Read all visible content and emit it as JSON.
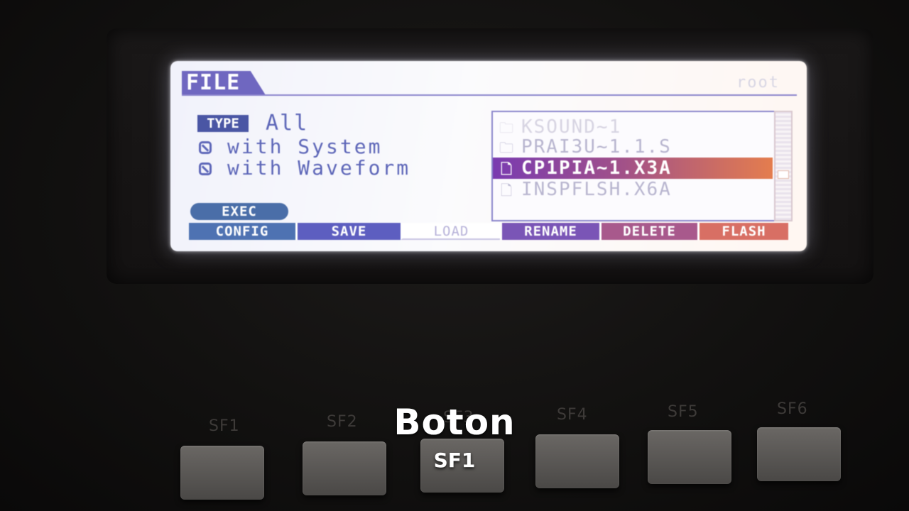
{
  "screen": {
    "title": "FILE",
    "path": "root",
    "type_label": "TYPE",
    "type_value": "All",
    "options": [
      {
        "label": "with System",
        "checked": true
      },
      {
        "label": "with Waveform",
        "checked": true
      }
    ],
    "exec_label": "EXEC",
    "files": [
      {
        "name": "KSOUND~1",
        "kind": "folder-icon",
        "selected": false
      },
      {
        "name": "PRAI3U~1.1.S",
        "kind": "folder-icon",
        "selected": false
      },
      {
        "name": "CP1PIA~1.X3A",
        "kind": "file-icon",
        "selected": true
      },
      {
        "name": "INSPFLSH.X6A",
        "kind": "file-icon",
        "selected": false
      }
    ],
    "softkeys": [
      "CONFIG",
      "SAVE",
      "LOAD",
      "RENAME",
      "DELETE",
      "FLASH"
    ],
    "active_softkey": "LOAD"
  },
  "hardware_buttons": [
    "SF1",
    "SF2",
    "SF3",
    "SF4",
    "SF5",
    "SF6"
  ],
  "caption": {
    "title": "Boton",
    "subtitle": "SF1"
  },
  "colors": {
    "lcd_accent": "#5d66b8",
    "selected_start": "#7a3bb0",
    "selected_end": "#e47d4e"
  }
}
